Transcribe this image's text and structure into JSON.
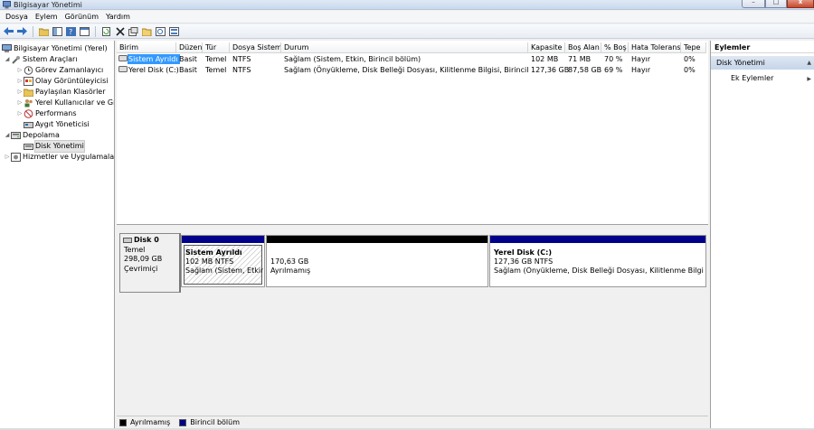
{
  "window": {
    "title": "Bilgisayar Yönetimi",
    "min": "–",
    "max": "□",
    "close": "x"
  },
  "menu": [
    "Dosya",
    "Eylem",
    "Görünüm",
    "Yardım"
  ],
  "tree": {
    "root": "Bilgisayar Yönetimi (Yerel)",
    "system_tools": "Sistem Araçları",
    "task_scheduler": "Görev Zamanlayıcı",
    "event_viewer": "Olay Görüntüleyicisi",
    "shared_folders": "Paylaşılan Klasörler",
    "local_users": "Yerel Kullanıcılar ve Gru",
    "performance": "Performans",
    "device_manager": "Aygıt Yöneticisi",
    "storage": "Depolama",
    "disk_management": "Disk Yönetimi",
    "services_apps": "Hizmetler ve Uygulamalar"
  },
  "table": {
    "headers": [
      "Birim",
      "Düzen",
      "Tür",
      "Dosya Sistemi",
      "Durum",
      "Kapasite",
      "Boş Alan",
      "% Boş",
      "Hata Toleransı",
      "Tepe"
    ],
    "rows": [
      [
        "Sistem Ayrıldı",
        "Basit",
        "Temel",
        "NTFS",
        "Sağlam (Sistem, Etkin, Birincil bölüm)",
        "102 MB",
        "71 MB",
        "70 %",
        "Hayır",
        "0%"
      ],
      [
        "Yerel Disk (C:)",
        "Basit",
        "Temel",
        "NTFS",
        "Sağlam (Önyükleme, Disk Belleği Dosyası, Kilitlenme Bilgisi, Birincil bölüm)",
        "127,36 GB",
        "87,58 GB",
        "69 %",
        "Hayır",
        "0%"
      ]
    ]
  },
  "disk": {
    "name": "Disk 0",
    "type": "Temel",
    "size": "298,09 GB",
    "status": "Çevrimiçi",
    "partitions": [
      {
        "title": "Sistem Ayrıldı",
        "size": "102 MB NTFS",
        "status": "Sağlam (Sistem, Etkin, Birincil bölüm)"
      },
      {
        "title": "",
        "size": "170,63 GB",
        "status": "Ayrılmamış"
      },
      {
        "title": "Yerel Disk  (C:)",
        "size": "127,36 GB NTFS",
        "status": "Sağlam (Önyükleme, Disk Belleği Dosyası, Kilitlenme Bilgisi, Birincil bölüm)"
      }
    ]
  },
  "legend": [
    {
      "label": "Ayrılmamış",
      "color": "#000000"
    },
    {
      "label": "Birincil bölüm",
      "color": "#00008b"
    }
  ],
  "actions": {
    "header": "Eylemler",
    "section": "Disk Yönetimi",
    "more": "Ek Eylemler"
  },
  "colors": {
    "primary_partition": "#00008b",
    "unallocated": "#000000",
    "selection": "#3399ff"
  }
}
